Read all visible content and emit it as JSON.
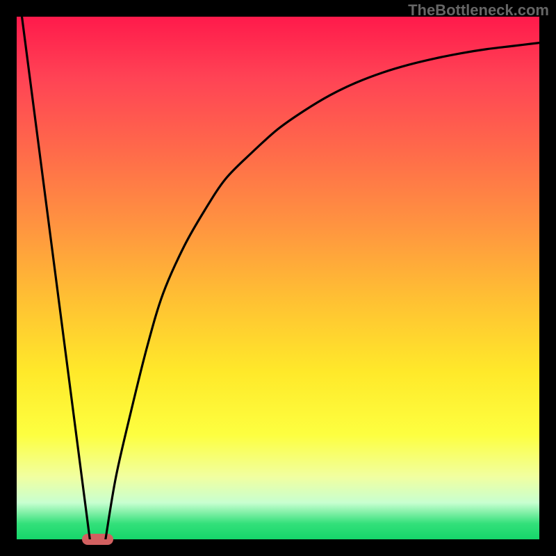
{
  "header": {
    "link_text": "TheBottleneck.com"
  },
  "colors": {
    "page_bg": "#000000",
    "gradient_top": "#ff1a4b",
    "gradient_bottom": "#15d66a",
    "curve": "#000000",
    "marker": "#d26060",
    "link": "#666666"
  },
  "chart_data": {
    "type": "line",
    "title": "",
    "xlabel": "",
    "ylabel": "",
    "legend": false,
    "axes": false,
    "x_range": [
      0,
      100
    ],
    "y_range": [
      0,
      100
    ],
    "series": [
      {
        "name": "left-leg",
        "shape": "linear",
        "points": [
          [
            1,
            100
          ],
          [
            14,
            0
          ]
        ]
      },
      {
        "name": "right-leg",
        "shape": "saturating",
        "points": [
          [
            17,
            0
          ],
          [
            19,
            12
          ],
          [
            22,
            25
          ],
          [
            25,
            37
          ],
          [
            28,
            47
          ],
          [
            32,
            56
          ],
          [
            36,
            63
          ],
          [
            40,
            69
          ],
          [
            45,
            74
          ],
          [
            50,
            78.5
          ],
          [
            55,
            82
          ],
          [
            60,
            85
          ],
          [
            65,
            87.4
          ],
          [
            70,
            89.3
          ],
          [
            75,
            90.8
          ],
          [
            80,
            92
          ],
          [
            85,
            93
          ],
          [
            90,
            93.8
          ],
          [
            95,
            94.4
          ],
          [
            100,
            95
          ]
        ]
      }
    ],
    "marker": {
      "x": 15.5,
      "y": 0,
      "width_pct": 6,
      "height_pct": 2
    },
    "background": {
      "type": "vertical_gradient",
      "from": "#ff1a4b",
      "to": "#15d66a"
    }
  }
}
